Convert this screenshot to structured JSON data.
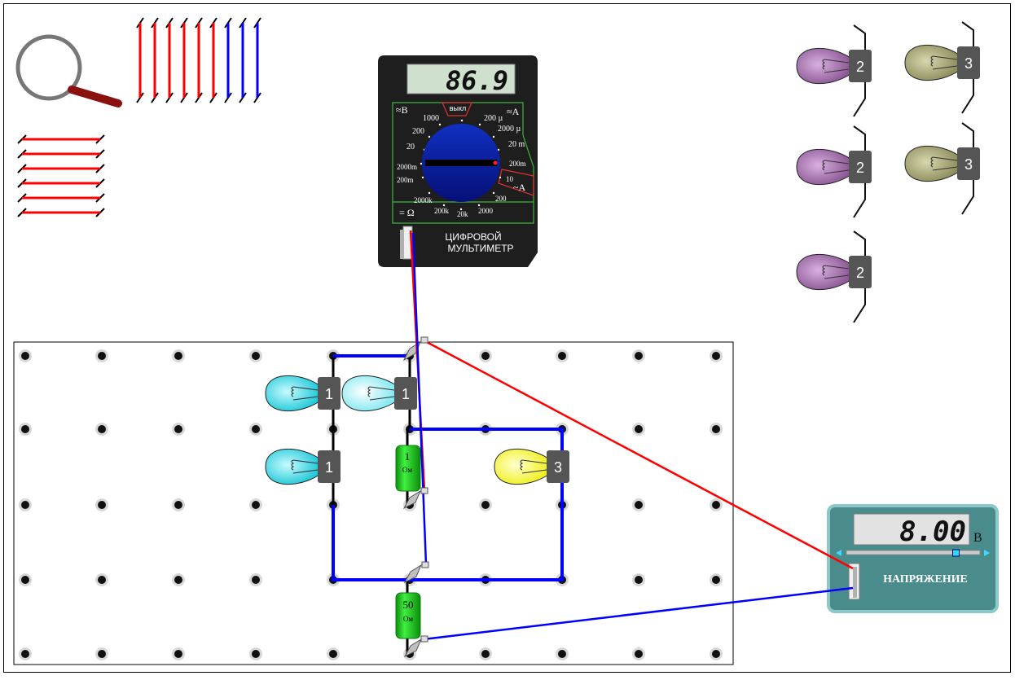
{
  "multimeter": {
    "display_value": "86.9",
    "title_line1": "ЦИФРОВОЙ",
    "title_line2": "МУЛЬТИМЕТР",
    "off_label": "выкл",
    "dc_voltage_symbol": "≈B",
    "dc_current_symbol": "≈A",
    "ac_current_symbol": "~A",
    "ohm_symbol": "= Ω",
    "scale": {
      "v1000": "1000",
      "v200": "200",
      "v20": "20",
      "v2000m": "2000m",
      "v200m": "200m",
      "a200u": "200 µ",
      "a2000u": "2000 µ",
      "a20m": "20 m",
      "a200m": "200m",
      "ac10": "10",
      "ac200": "200",
      "ac2000": "2000",
      "r2000k": "2000k",
      "r200k": "200k",
      "r20k": "20k"
    }
  },
  "power_supply": {
    "display_value": "8.00",
    "unit": "В",
    "label": "НАПРЯЖЕНИЕ",
    "slider_level": 0.82
  },
  "tray_bulbs": [
    {
      "label": "2"
    },
    {
      "label": "3"
    },
    {
      "label": "2"
    },
    {
      "label": "3"
    },
    {
      "label": "2"
    }
  ],
  "board_bulbs": [
    {
      "label": "1"
    },
    {
      "label": "1"
    },
    {
      "label": "1"
    },
    {
      "label": "3"
    }
  ],
  "resistors": [
    {
      "value": "1",
      "unit": "Ом"
    },
    {
      "value": "50",
      "unit": "Ом"
    }
  ],
  "colors": {
    "wire_red": "#ff0000",
    "wire_blue": "#0000ff",
    "multimeter_body": "#1e1e1e",
    "dial": "#0a1aa0",
    "resistor_green": "#22cc22",
    "supply_body": "#4a8c8c",
    "bulb_cyan": "#30d8e0",
    "bulb_yellow": "#ffff40",
    "bulb_purple": "#a070a8",
    "bulb_olive": "#a0a070"
  }
}
